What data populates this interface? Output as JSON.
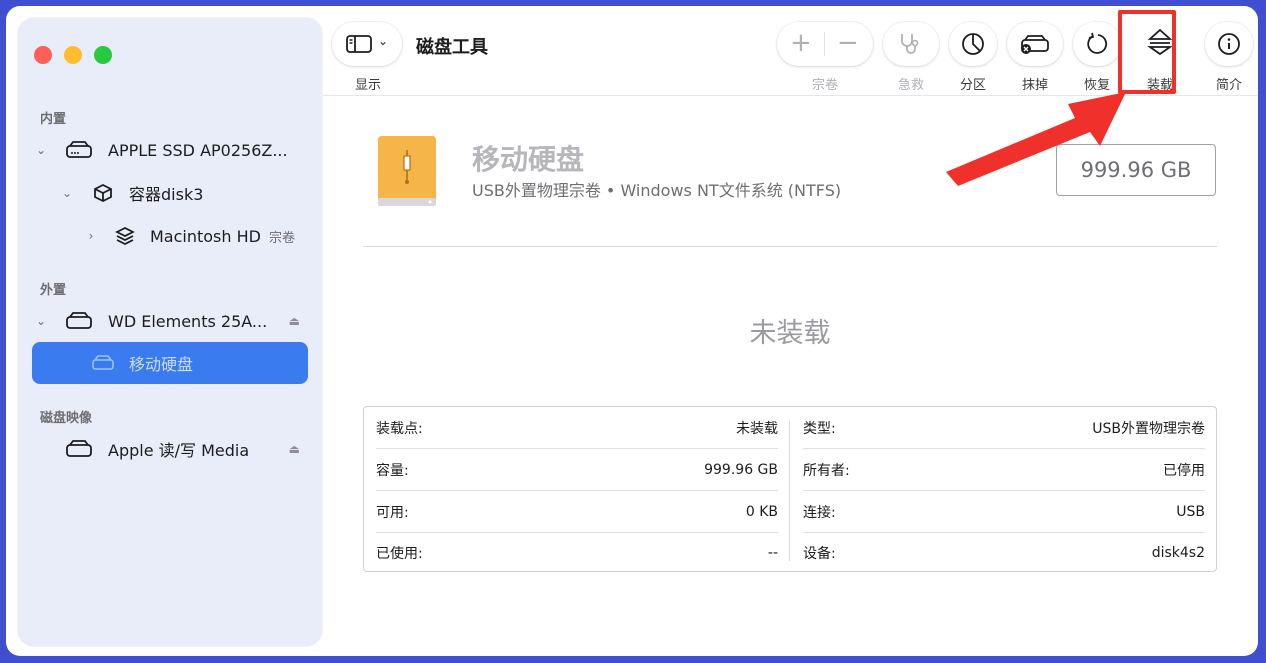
{
  "app": {
    "title": "磁盘工具"
  },
  "toolbar": {
    "view_label": "显示",
    "add_symbol": "+",
    "remove_symbol": "−",
    "volume_label": "宗卷",
    "firstaid_label": "急救",
    "partition_label": "分区",
    "erase_label": "抹掉",
    "restore_label": "恢复",
    "mount_label": "装载",
    "info_label": "简介"
  },
  "sidebar": {
    "internal_header": "内置",
    "external_header": "外置",
    "images_header": "磁盘映像",
    "items": [
      {
        "label": "APPLE SSD AP0256Z...",
        "icon": "internal-disk-icon"
      },
      {
        "label": "容器disk3",
        "icon": "container-icon"
      },
      {
        "label": "Macintosh HD",
        "tag": "宗卷",
        "icon": "volume-stack-icon"
      },
      {
        "label": "WD Elements 25A...",
        "icon": "external-disk-icon"
      },
      {
        "label": "移动硬盘",
        "icon": "volume-disk-icon"
      },
      {
        "label": "Apple 读/写 Media",
        "icon": "disk-image-icon"
      }
    ],
    "eject_symbol": "⏏"
  },
  "disk": {
    "name": "移动硬盘",
    "description": "USB外置物理宗卷 • Windows NT文件系统 (NTFS)",
    "capacity": "999.96 GB",
    "status": "未装载"
  },
  "info": {
    "left": [
      {
        "key": "装载点:",
        "value": "未装载"
      },
      {
        "key": "容量:",
        "value": "999.96 GB"
      },
      {
        "key": "可用:",
        "value": "0 KB"
      },
      {
        "key": "已使用:",
        "value": "--"
      }
    ],
    "right": [
      {
        "key": "类型:",
        "value": "USB外置物理宗卷"
      },
      {
        "key": "所有者:",
        "value": "已停用"
      },
      {
        "key": "连接:",
        "value": "USB"
      },
      {
        "key": "设备:",
        "value": "disk4s2"
      }
    ]
  },
  "colors": {
    "accent": "#3a7bf0",
    "annotation": "#f0302a",
    "disk_orange": "#f2a93b"
  }
}
